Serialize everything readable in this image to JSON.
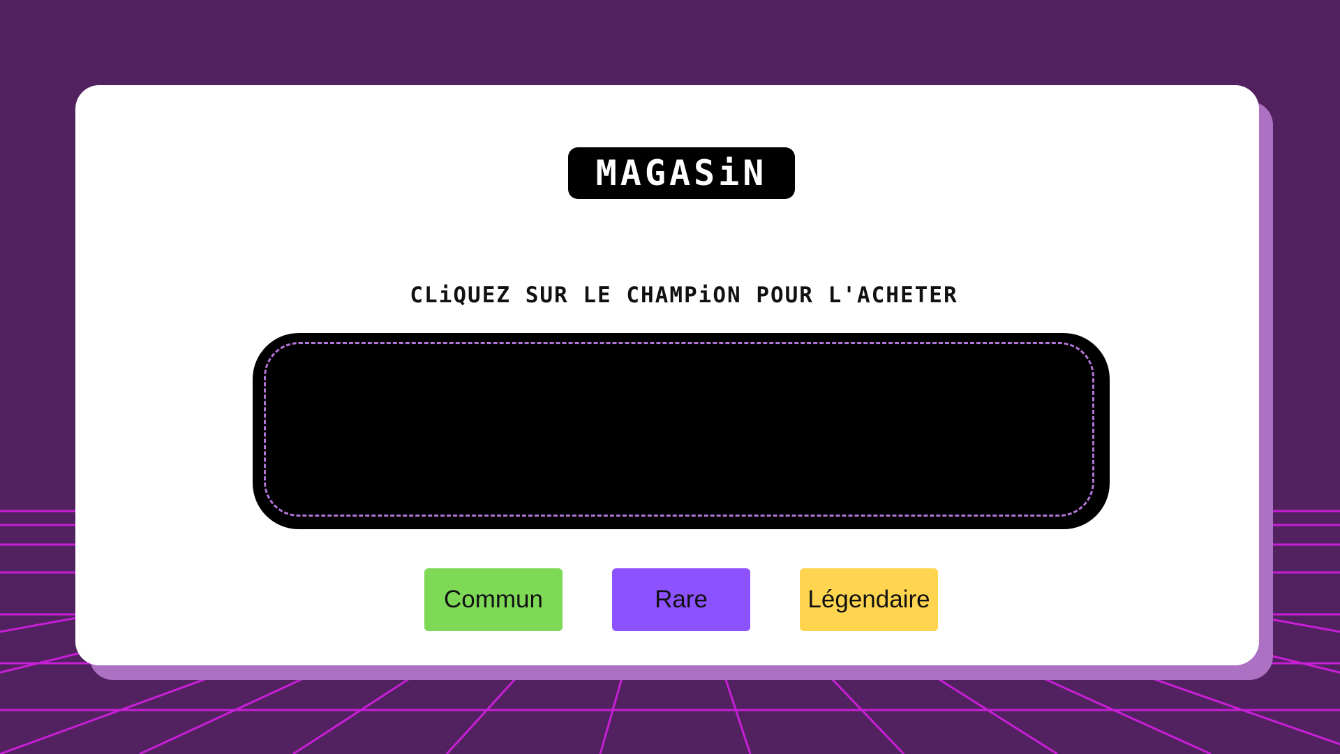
{
  "shop": {
    "title": "MAGASiN",
    "instruction": "CLiQUEZ SUR LE CHAMPiON POUR L'ACHETER"
  },
  "rarity_buttons": [
    {
      "label": "Commun",
      "color": "#7ed957"
    },
    {
      "label": "Rare",
      "color": "#8c52ff"
    },
    {
      "label": "Légendaire",
      "color": "#ffd54f"
    }
  ],
  "theme": {
    "background": "#52215f",
    "grid_line": "#c71fd6",
    "card_shadow": "#ad71c4",
    "panel_dash": "#b475d8"
  }
}
